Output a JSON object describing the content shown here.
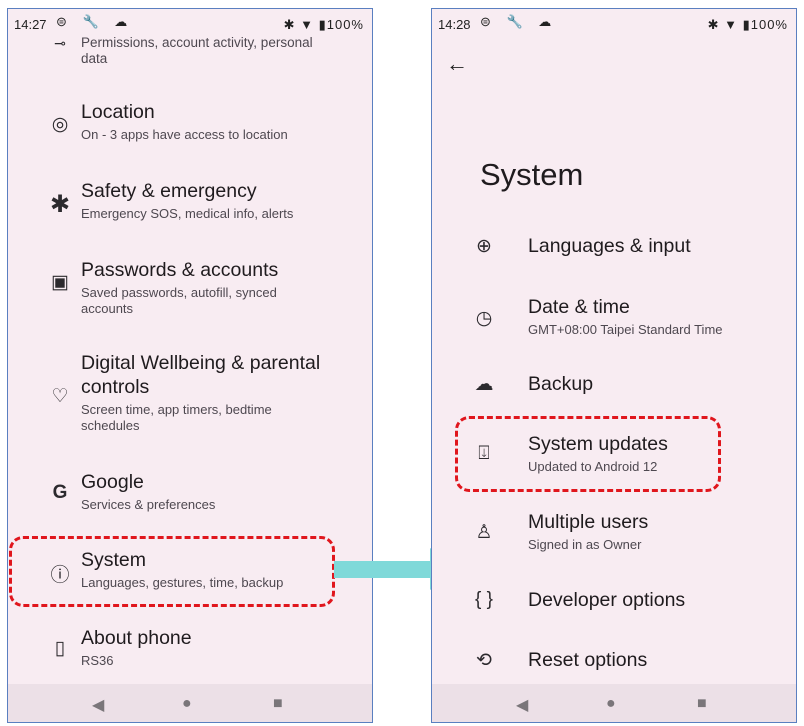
{
  "left": {
    "status": {
      "time": "14:27",
      "icons": "⊜ 🔧 ☁",
      "right": "✱ ▼ ▮100%"
    },
    "items": [
      {
        "name": "privacy",
        "icon": "⊸",
        "title": "",
        "sub": "Permissions, account activity, personal data"
      },
      {
        "name": "location",
        "icon": "◎",
        "title": "Location",
        "sub": "On - 3 apps have access to location"
      },
      {
        "name": "safety",
        "icon": "✱",
        "title": "Safety & emergency",
        "sub": "Emergency SOS, medical info, alerts"
      },
      {
        "name": "passwords",
        "icon": "▣",
        "title": "Passwords & accounts",
        "sub": "Saved passwords, autofill, synced accounts"
      },
      {
        "name": "wellbeing",
        "icon": "♡",
        "title": "Digital Wellbeing & parental controls",
        "sub": "Screen time, app timers, bedtime schedules"
      },
      {
        "name": "google",
        "icon": "G",
        "title": "Google",
        "sub": "Services & preferences"
      },
      {
        "name": "system",
        "icon": "ⓘ",
        "title": "System",
        "sub": "Languages, gestures, time, backup"
      },
      {
        "name": "about",
        "icon": "▯",
        "title": "About phone",
        "sub": "RS36"
      }
    ],
    "nav": {
      "back": "◀",
      "home": "●",
      "recents": "■"
    }
  },
  "right": {
    "status": {
      "time": "14:28",
      "icons": "⊜ 🔧 ☁",
      "right": "✱ ▼ ▮100%"
    },
    "back_icon": "←",
    "title": "System",
    "items": [
      {
        "name": "languages",
        "icon": "⊕",
        "title": "Languages & input",
        "sub": ""
      },
      {
        "name": "datetime",
        "icon": "◷",
        "title": "Date & time",
        "sub": "GMT+08:00 Taipei Standard Time"
      },
      {
        "name": "backup",
        "icon": "☁",
        "title": "Backup",
        "sub": ""
      },
      {
        "name": "system-updates",
        "icon": "⍗",
        "title": "System updates",
        "sub": "Updated to Android 12"
      },
      {
        "name": "multiple-users",
        "icon": "♙",
        "title": "Multiple users",
        "sub": "Signed in as Owner"
      },
      {
        "name": "developer",
        "icon": "{ }",
        "title": "Developer options",
        "sub": ""
      },
      {
        "name": "reset",
        "icon": "⟲",
        "title": "Reset options",
        "sub": ""
      }
    ],
    "nav": {
      "back": "◀",
      "home": "●",
      "recents": "■"
    }
  },
  "colors": {
    "highlight": "#e0161d",
    "arrow": "#7fd9d9",
    "background": "#f8ecf2",
    "frame": "#5a7fc0"
  }
}
